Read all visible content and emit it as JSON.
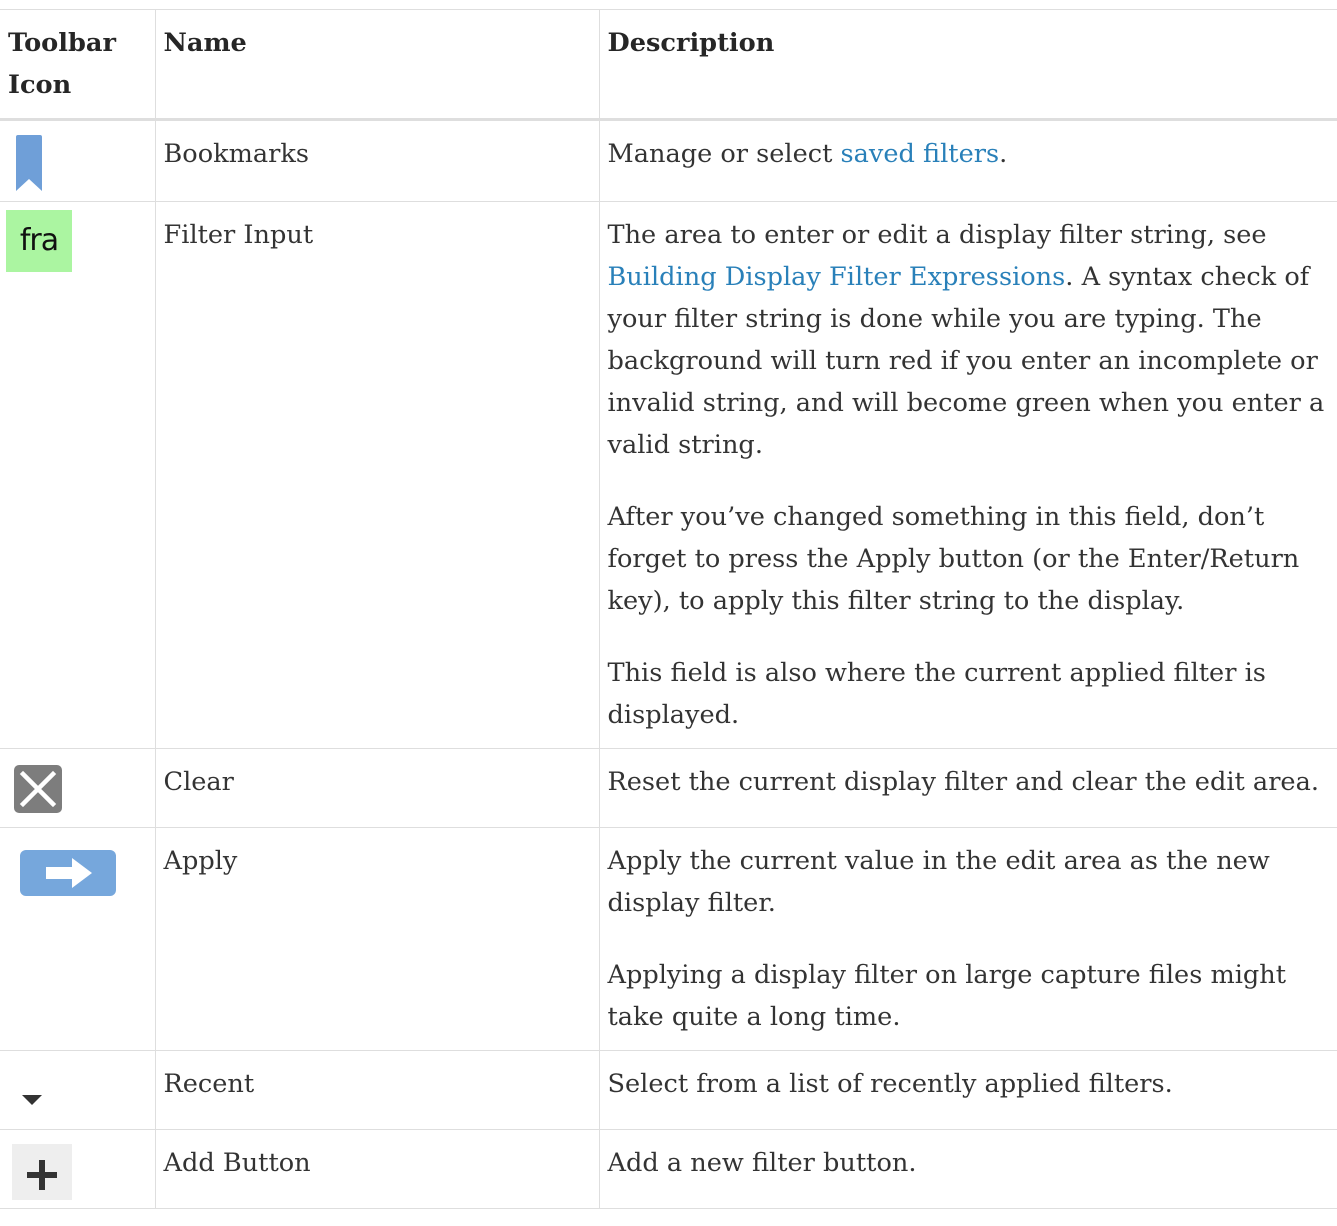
{
  "table": {
    "headers": {
      "icon": "Toolbar Icon",
      "name": "Name",
      "description": "Description"
    },
    "rows": [
      {
        "icon": "bookmark-icon",
        "name": "Bookmarks",
        "desc_before": "Manage or select ",
        "desc_link": "saved filters",
        "desc_after": "."
      },
      {
        "icon": "filter-input-icon",
        "icon_text": "fra",
        "name": "Filter Input",
        "desc_before": "The area to enter or edit a display filter string, see ",
        "desc_link": "Building Display Filter Expressions",
        "desc_after": ". A syntax check of your filter string is done while you are typing. The background will turn red if you enter an incomplete or invalid string, and will become green when you enter a valid string.",
        "desc_p2": "After you’ve changed something in this field, don’t forget to press the Apply button (or the Enter/Return key), to apply this filter string to the display.",
        "desc_p3": "This field is also where the current applied filter is displayed."
      },
      {
        "icon": "clear-icon",
        "name": "Clear",
        "desc": "Reset the current display filter and clear the edit area."
      },
      {
        "icon": "apply-arrow-icon",
        "name": "Apply",
        "desc": "Apply the current value in the edit area as the new display filter.",
        "desc_p2": "Applying a display filter on large capture files might take quite a long time."
      },
      {
        "icon": "recent-dropdown-icon",
        "name": "Recent",
        "desc": "Select from a list of recently applied filters."
      },
      {
        "icon": "add-icon",
        "name": "Add Button",
        "desc": "Add a new filter button."
      }
    ]
  },
  "colors": {
    "link": "#2980b9",
    "border": "#dedede",
    "bookmark": "#6f9fd8",
    "filter_ok": "#abf5a1",
    "clear_bg": "#7d7d7d",
    "apply_bg": "#76a7dc"
  }
}
